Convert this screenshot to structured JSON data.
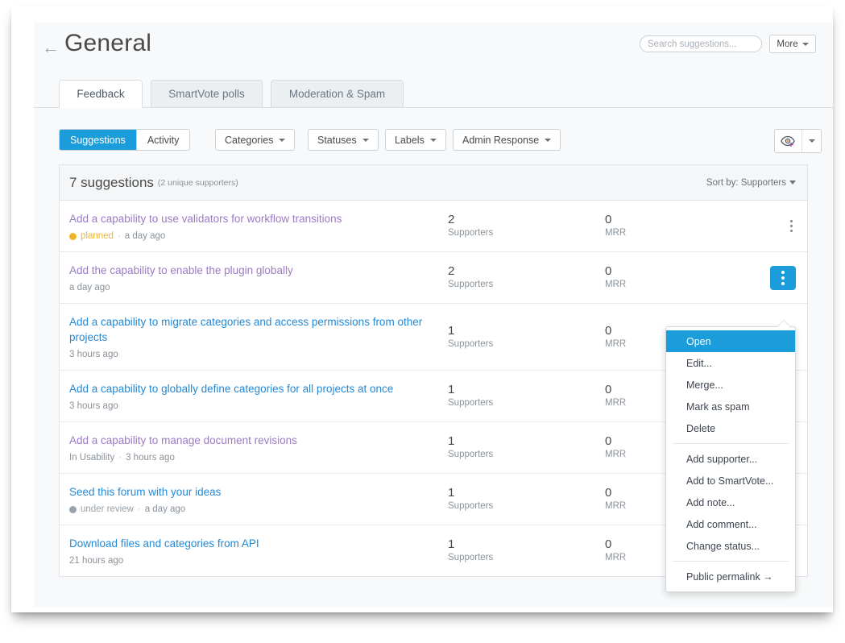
{
  "header": {
    "back_icon": "back-arrow-icon",
    "title": "General",
    "search_placeholder": "Search suggestions...",
    "search_value": "",
    "more_label": "More"
  },
  "tabs": [
    {
      "label": "Feedback",
      "active": true
    },
    {
      "label": "SmartVote polls",
      "active": false
    },
    {
      "label": "Moderation & Spam",
      "active": false
    }
  ],
  "toolbar": {
    "segments": [
      {
        "label": "Suggestions",
        "active": true
      },
      {
        "label": "Activity",
        "active": false
      }
    ],
    "filters": [
      {
        "label": "Categories"
      },
      {
        "label": "Statuses"
      },
      {
        "label": "Labels"
      },
      {
        "label": "Admin Response"
      }
    ],
    "eye_icon": "eye-plus-icon",
    "eye_caret_icon": "chevron-down-icon"
  },
  "list": {
    "count_label": "7 suggestions",
    "count_sub": "(2 unique supporters)",
    "sort_label": "Sort by: Supporters",
    "supporters_label": "Supporters",
    "mrr_label": "MRR",
    "rows": [
      {
        "title": "Add a capability to use validators for workflow transitions",
        "visited": true,
        "status": "planned",
        "status_color": "#f0b429",
        "time": "a day ago",
        "category": "",
        "supporters": "2",
        "mrr": "0",
        "menu_open": false
      },
      {
        "title": "Add the capability to enable the plugin globally",
        "visited": true,
        "status": "",
        "status_color": "",
        "time": "a day ago",
        "category": "",
        "supporters": "2",
        "mrr": "0",
        "menu_open": true
      },
      {
        "title": "Add a capability to migrate categories and access permissions from other projects",
        "visited": false,
        "status": "",
        "status_color": "",
        "time": "3 hours ago",
        "category": "",
        "supporters": "1",
        "mrr": "0",
        "menu_open": false
      },
      {
        "title": "Add a capability to globally define categories for all projects at once",
        "visited": false,
        "status": "",
        "status_color": "",
        "time": "3 hours ago",
        "category": "",
        "supporters": "1",
        "mrr": "0",
        "menu_open": false
      },
      {
        "title": "Add a capability to manage document revisions",
        "visited": true,
        "status": "",
        "status_color": "",
        "time": "3 hours ago",
        "category": "In Usability",
        "supporters": "1",
        "mrr": "0",
        "menu_open": false
      },
      {
        "title": "Seed this forum with your ideas",
        "visited": false,
        "status": "under review",
        "status_color": "#9aa2a9",
        "time": "a day ago",
        "category": "",
        "supporters": "1",
        "mrr": "0",
        "menu_open": false
      },
      {
        "title": "Download files and categories from API",
        "visited": false,
        "status": "",
        "status_color": "",
        "time": "21 hours ago",
        "category": "",
        "supporters": "1",
        "mrr": "0",
        "menu_open": false
      }
    ]
  },
  "context_menu": {
    "groups": [
      [
        "Open",
        "Edit...",
        "Merge...",
        "Mark as spam",
        "Delete"
      ],
      [
        "Add supporter...",
        "Add to SmartVote...",
        "Add note...",
        "Add comment...",
        "Change status..."
      ],
      [
        "Public permalink →"
      ]
    ],
    "highlighted": "Open"
  },
  "colors": {
    "accent": "#1b9ddb",
    "link": "#2389d4",
    "link_visited": "#9b7bc4",
    "status_planned": "#f0b429",
    "status_under_review": "#9aa2a9"
  }
}
